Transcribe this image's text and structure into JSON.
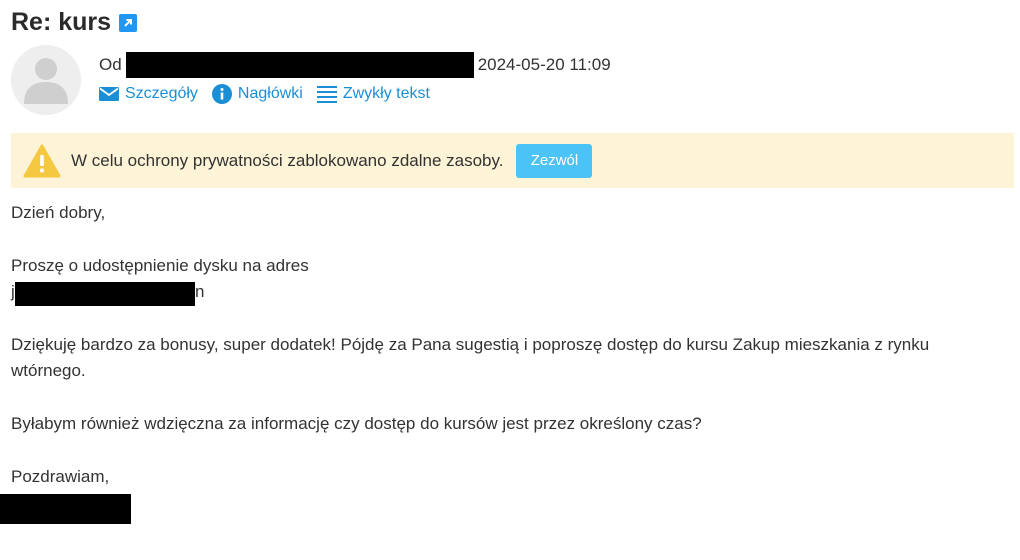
{
  "message": {
    "subject": "Re: kurs",
    "from_label": "Od",
    "date": "2024-05-20 11:09"
  },
  "actions": [
    {
      "label": "Szczegóły",
      "icon": "envelope-icon"
    },
    {
      "label": "Nagłówki",
      "icon": "info-icon"
    },
    {
      "label": "Zwykły tekst",
      "icon": "list-icon"
    }
  ],
  "privacy_notice": {
    "text": "W celu ochrony prywatności zablokowano zdalne zasoby.",
    "button_label": "Zezwól",
    "icon": "warning-icon"
  },
  "body": {
    "greeting": "Dzień dobry,",
    "request_line": "Proszę o udostępnienie dysku na adres",
    "address_start": "j",
    "address_end": "n",
    "thanks_paragraph": "Dziękuję bardzo za bonusy, super dodatek! Pójdę za Pana sugestią i poproszę dostęp do kursu Zakup mieszkania z rynku wtórnego.",
    "question_paragraph": "Byłabym również wdzięczna za informację czy dostęp do kursów jest przez określony czas?",
    "closing": "Pozdrawiam,"
  },
  "colors": {
    "link": "#1a8fd6",
    "notice_bg": "#fdf3d6",
    "button_bg": "#4cc3f7",
    "warning": "#f5c842"
  }
}
